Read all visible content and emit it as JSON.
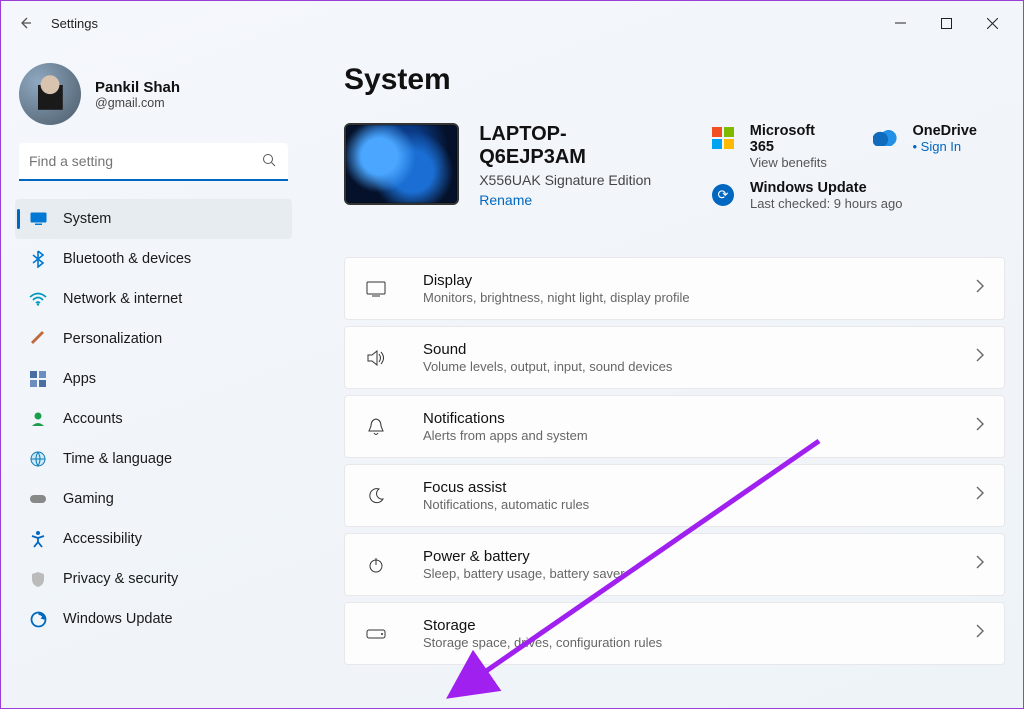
{
  "window": {
    "title": "Settings"
  },
  "profile": {
    "name": "Pankil Shah",
    "email": "@gmail.com"
  },
  "search": {
    "placeholder": "Find a setting"
  },
  "sidebar": {
    "items": [
      {
        "label": "System",
        "icon": "monitor",
        "active": true
      },
      {
        "label": "Bluetooth & devices",
        "icon": "bluetooth"
      },
      {
        "label": "Network & internet",
        "icon": "wifi"
      },
      {
        "label": "Personalization",
        "icon": "brush"
      },
      {
        "label": "Apps",
        "icon": "grid"
      },
      {
        "label": "Accounts",
        "icon": "person"
      },
      {
        "label": "Time & language",
        "icon": "globe"
      },
      {
        "label": "Gaming",
        "icon": "gamepad"
      },
      {
        "label": "Accessibility",
        "icon": "accessibility"
      },
      {
        "label": "Privacy & security",
        "icon": "shield"
      },
      {
        "label": "Windows Update",
        "icon": "update"
      }
    ]
  },
  "page": {
    "title": "System",
    "device": {
      "name": "LAPTOP-Q6EJP3AM",
      "model": "X556UAK Signature Edition",
      "rename": "Rename"
    },
    "tiles": [
      {
        "title": "Microsoft 365",
        "sub": "View benefits",
        "icon": "mslogo"
      },
      {
        "title": "OneDrive",
        "sub": "Sign In",
        "icon": "onedrive",
        "sublink": true
      },
      {
        "title": "Windows Update",
        "sub": "Last checked: 9 hours ago",
        "icon": "wupdate",
        "span2": true
      }
    ],
    "rows": [
      {
        "title": "Display",
        "sub": "Monitors, brightness, night light, display profile",
        "icon": "display"
      },
      {
        "title": "Sound",
        "sub": "Volume levels, output, input, sound devices",
        "icon": "sound"
      },
      {
        "title": "Notifications",
        "sub": "Alerts from apps and system",
        "icon": "bell"
      },
      {
        "title": "Focus assist",
        "sub": "Notifications, automatic rules",
        "icon": "moon"
      },
      {
        "title": "Power & battery",
        "sub": "Sleep, battery usage, battery saver",
        "icon": "power"
      },
      {
        "title": "Storage",
        "sub": "Storage space, drives, configuration rules",
        "icon": "storage"
      }
    ]
  }
}
